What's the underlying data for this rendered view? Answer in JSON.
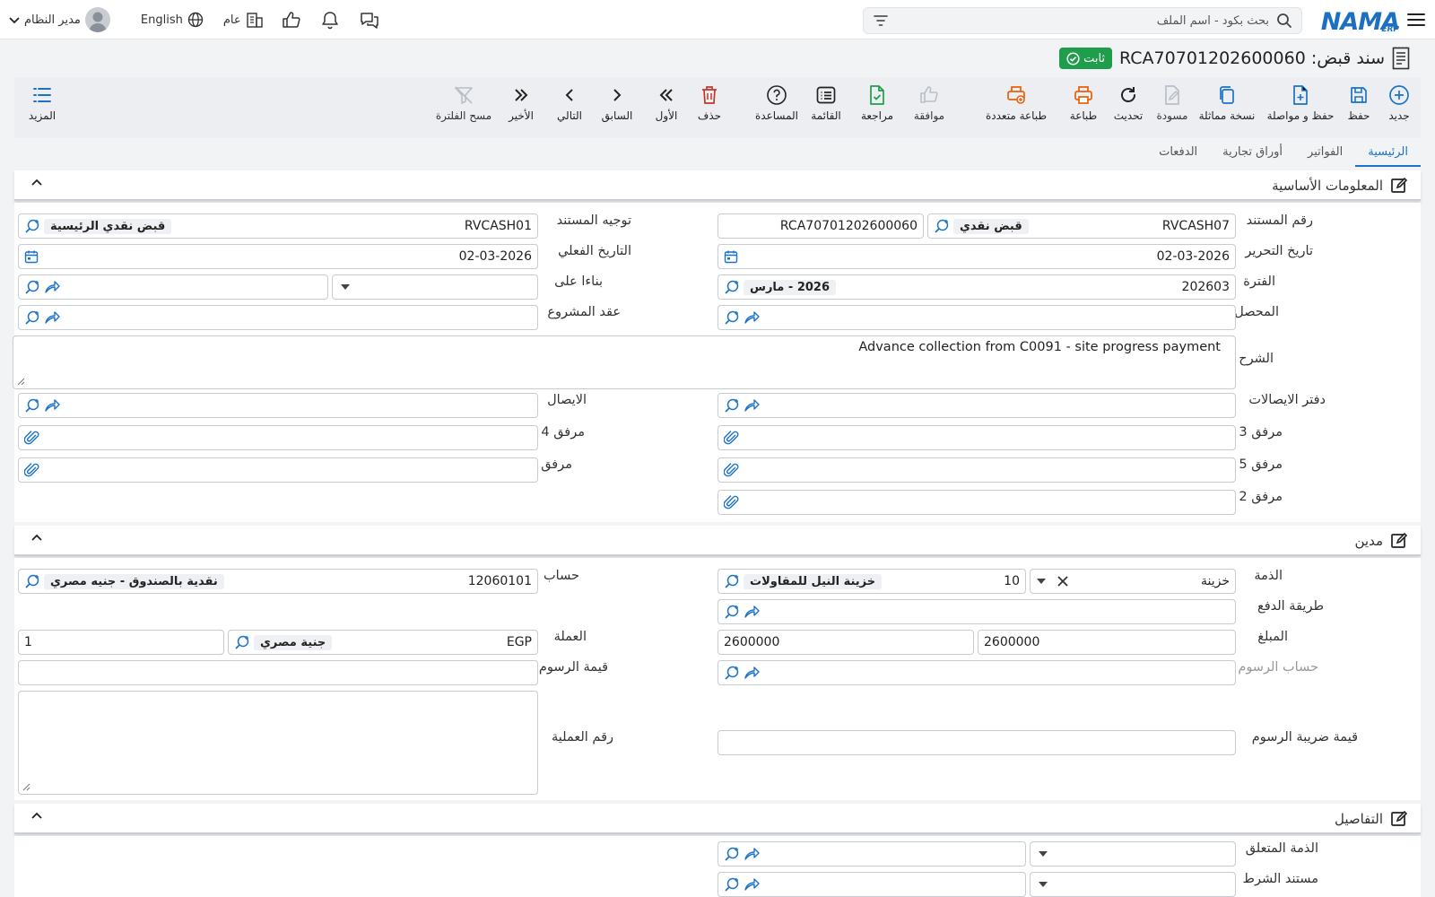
{
  "topbar": {
    "search_placeholder": "بحث بكود - اسم الملف",
    "logo_text": "NAMA",
    "logo_sub": "ERP",
    "language": "English",
    "branch": "عام",
    "user": "مدير النظام"
  },
  "document": {
    "title": "سند قبض: RCA70701202600060",
    "status": "ثابت"
  },
  "toolbar": {
    "new": "جديد",
    "save": "حفظ",
    "save_continue": "حفظ و مواصلة",
    "duplicate": "نسخة مماثلة",
    "draft": "مسودة",
    "refresh": "تحديث",
    "print": "طباعة",
    "multi_print": "طباعة متعددة",
    "approve": "موافقة",
    "review": "مراجعة",
    "list": "القائمة",
    "help": "المساعدة",
    "delete": "حذف",
    "first": "الأول",
    "previous": "السابق",
    "next": "التالي",
    "last": "الأخير",
    "clear_filter": "مسح الفلترة",
    "more": "المزيد"
  },
  "tabs": [
    "الرئيسية",
    "الفواتير",
    "أوراق تجارية",
    "الدفعات"
  ],
  "basic": {
    "title": "المعلومات الأساسية",
    "doc_number": {
      "label": "رقم المستند",
      "code": "RVCASH07",
      "chip": "قبض نقدي",
      "number": "RCA70701202600060"
    },
    "doc_direction": {
      "label": "توجيه المستند",
      "code": "RVCASH01",
      "chip": "قبض نقدي الرئيسية"
    },
    "issue_date": {
      "label": "تاريخ التحرير",
      "value": "02-03-2026"
    },
    "actual_date": {
      "label": "التاريخ الفعلي",
      "value": "02-03-2026"
    },
    "period": {
      "label": "الفترة",
      "code": "202603",
      "chip": "2026 - مارس"
    },
    "based_on": {
      "label": "بناءا على"
    },
    "collector": {
      "label": "المحصل"
    },
    "project_contract": {
      "label": "عقد المشروع"
    },
    "description": {
      "label": "الشرح",
      "value": "Advance collection from C0091 - site progress payment"
    },
    "receipt_book": {
      "label": "دفتر الايصالات"
    },
    "receipt": {
      "label": "الايصال"
    },
    "attachment3": {
      "label": "مرفق 3"
    },
    "attachment4": {
      "label": "مرفق 4"
    },
    "attachment5": {
      "label": "مرفق 5"
    },
    "attachment": {
      "label": "مرفق"
    },
    "attachment2": {
      "label": "مرفق 2"
    }
  },
  "debit": {
    "title": "مدين",
    "subsidiary": {
      "label": "الذمة",
      "type": "خزينة",
      "code": "10",
      "chip": "خزينة النيل للمقاولات"
    },
    "account": {
      "label": "حساب",
      "code": "12060101",
      "chip": "نقدية بالصندوق - جنيه مصري"
    },
    "payment_method": {
      "label": "طريقة الدفع"
    },
    "amount": {
      "label": "المبلغ",
      "value1": "2600000",
      "value2": "2600000"
    },
    "currency": {
      "label": "العملة",
      "code": "EGP",
      "chip": "جنية مصري",
      "rate": "1"
    },
    "fees_account": {
      "label": "حساب الرسوم"
    },
    "fees_value": {
      "label": "قيمة الرسوم"
    },
    "fees_tax": {
      "label": "قيمة ضريبة الرسوم"
    },
    "operation_no": {
      "label": "رقم العملية"
    }
  },
  "details": {
    "title": "التفاصيل",
    "related_subsidiary": {
      "label": "الذمة المتعلق"
    },
    "partial_label": "مستند الشرط"
  },
  "colors": {
    "accent": "#1a73c8",
    "green": "#1e9e4a",
    "orange": "#e8600c",
    "red": "#c0392b"
  }
}
